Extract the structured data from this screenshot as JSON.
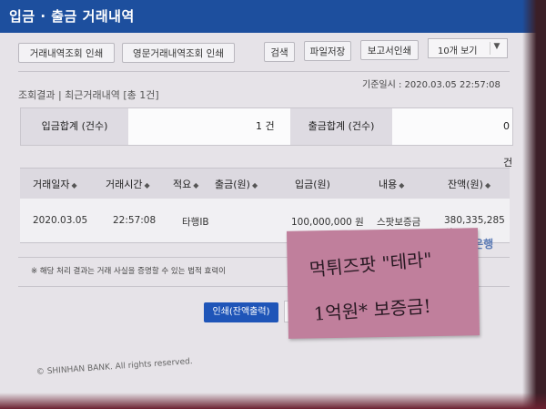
{
  "header": {
    "title": "입금 · 출금 거래내역"
  },
  "toolbar": {
    "print_history_label": "거래내역조회 인쇄",
    "print_english_label": "영문거래내역조회 인쇄",
    "search_label": "검색",
    "file_save_label": "파일저장",
    "report_print_label": "보고서인쇄",
    "page_size_value": "10개 보기"
  },
  "result": {
    "query_label": "조회결과 | 최근거래내역 [총 1건]",
    "timestamp": "기준일시 : 2020.03.05 22:57:08"
  },
  "summary": {
    "deposit_label": "입금합계 (건수)",
    "deposit_count": "1 건",
    "withdraw_label": "출금합계 (건수)",
    "withdraw_count": "0 건"
  },
  "table": {
    "headers": [
      "거래일자",
      "거래시간",
      "적요",
      "출금(원)",
      "입금(원)",
      "내용",
      "잔액(원)"
    ],
    "rows": [
      [
        "2020.03.05",
        "22:57:08",
        "타행IB",
        "",
        "100,000,000 원",
        "스팟보증금",
        "380,335,285 원"
      ]
    ]
  },
  "notice": "※ 해당 처리 결과는 거래 사실을 증명할 수 있는 법적 효력이",
  "bank_logo": "신한은행",
  "print_button_label": "인쇄(잔액출력)",
  "copyright": "© SHINHAN BANK. All rights reserved.",
  "sticky_note": {
    "line1": "먹튀즈팟 \"테라\"",
    "line2": "1억원* 보증금!"
  },
  "colors": {
    "header_blue": "#1d4f9e",
    "button_blue": "#1f55b8",
    "note_pink": "#c07f9c"
  }
}
